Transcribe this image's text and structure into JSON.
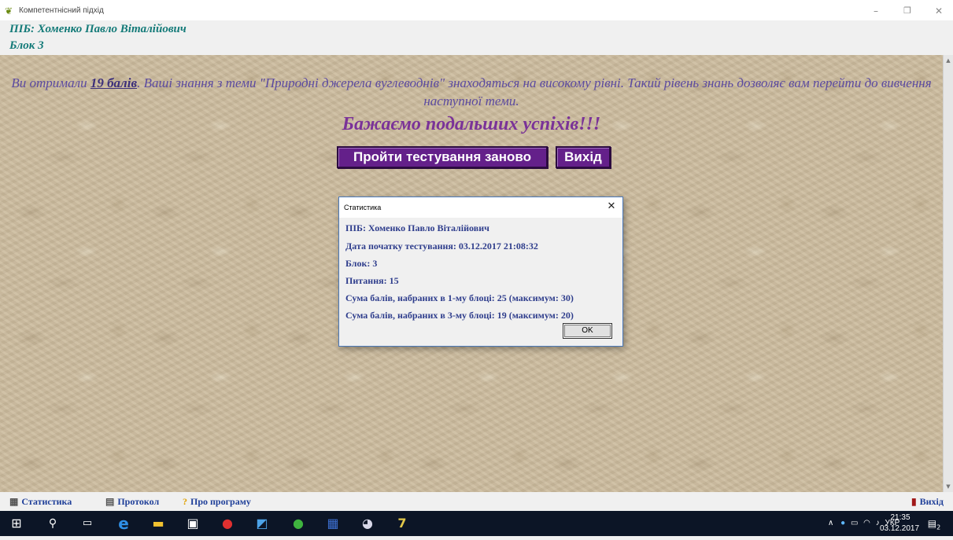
{
  "window": {
    "title": "Компетентнісний підхід",
    "minimize": "–",
    "maximize": "❐",
    "close": "✕"
  },
  "header": {
    "name_line": "ПІБ: Хоменко Павло Віталійович",
    "block_line": "Блок 3"
  },
  "result": {
    "text_before": "Ви отримали ",
    "score": "19 балів",
    "text_after": ". Ваші знання з теми \"Природні джерела вуглеводнів\" знаходяться на високому рівні. Такий рівень знань дозволяє вам перейти до вивчення наступної теми.",
    "wish": "Бажаємо подальших успіхів!!!",
    "retry_button": "Пройти тестування заново",
    "exit_button": "Вихід"
  },
  "dialog": {
    "title": "Статистика",
    "close": "✕",
    "lines": [
      "ПІБ: Хоменко Павло Віталійович",
      "Дата початку тестування: 03.12.2017 21:08:32",
      "Блок: 3",
      "Питання: 15",
      "Сума балів, набраних в 1-му блоці: 25 (максимум: 30)",
      "Сума балів, набраних в 3-му блоці: 19 (максимум: 20)"
    ],
    "ok_button": "OK"
  },
  "bottom_menu": {
    "stats": "Статистика",
    "protocol": "Протокол",
    "about": "Про програму",
    "exit": "Вихід"
  },
  "taskbar": {
    "icons": [
      "windows-start-icon",
      "search-icon",
      "task-view-icon",
      "edge-icon",
      "file-explorer-icon",
      "store-icon",
      "yandex-icon",
      "app-icon",
      "utorrent-icon",
      "word-icon",
      "paint-icon",
      "test-app-icon"
    ],
    "tray_lang": "УКР",
    "time": "21:35",
    "date": "03.12.2017",
    "notifications": "2"
  },
  "colors": {
    "header_text": "#137a78",
    "result_text": "#5b4aa0",
    "wish_text": "#7a3298",
    "button_bg": "#64208a",
    "menu_text": "#1f3f99",
    "taskbar_bg": "#0c1526"
  }
}
